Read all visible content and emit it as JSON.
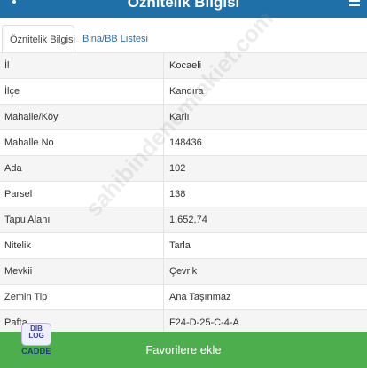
{
  "header": {
    "title": "Öznitelik Bilgisi"
  },
  "tabs": [
    {
      "label": "Öznitelik Bilgisi",
      "active": true
    },
    {
      "label": "Bina/BB Listesi",
      "active": false
    }
  ],
  "rows": [
    {
      "label": "İl",
      "value": "Kocaeli"
    },
    {
      "label": "İlçe",
      "value": "Kandıra"
    },
    {
      "label": "Mahalle/Köy",
      "value": "Karlı"
    },
    {
      "label": "Mahalle No",
      "value": "148436"
    },
    {
      "label": "Ada",
      "value": "102"
    },
    {
      "label": "Parsel",
      "value": "138"
    },
    {
      "label": "Tapu Alanı",
      "value": "1.652,74"
    },
    {
      "label": "Nitelik",
      "value": "Tarla"
    },
    {
      "label": "Mevkii",
      "value": "Çevrik"
    },
    {
      "label": "Zemin Tip",
      "value": "Ana Taşınmaz"
    },
    {
      "label": "Pafta",
      "value": "F24-D-25-C-4-A"
    }
  ],
  "watermark": "sahibindenemlakiet.com",
  "footer": {
    "favorite_button": "Favorilere ekle"
  },
  "logo": {
    "badge_lines": [
      "DİB",
      "LOG"
    ],
    "caption": "CADDE"
  },
  "colors": {
    "header_bg": "#1f6fa8",
    "tab_link": "#2a6fb0",
    "button_bg": "#4cae4c"
  },
  "icons": {
    "menu": "kebab-menu-icon",
    "header_right": "menu-lines-icon"
  }
}
